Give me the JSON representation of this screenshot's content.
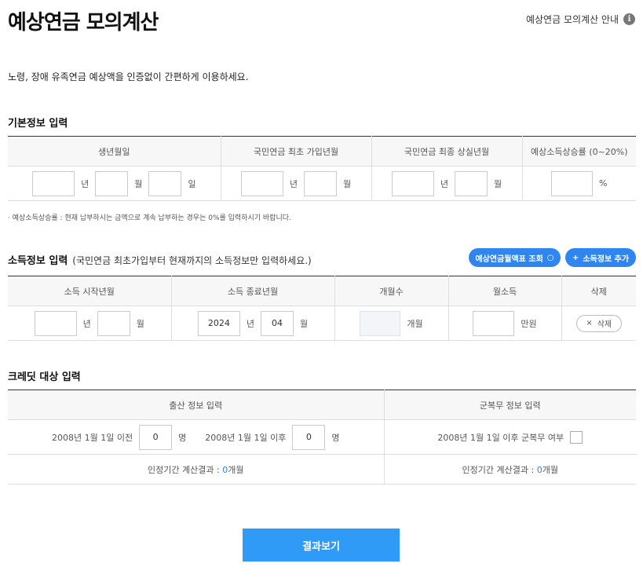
{
  "header": {
    "title": "예상연금 모의계산",
    "guide_label": "예상연금 모의계산 안내",
    "guide_icon": "info-icon",
    "guide_icon_glyph": "i"
  },
  "intro": "노령, 장애 유족연금 예상액을 인증없이 간편하게 이용하세요.",
  "basic": {
    "title": "기본정보 입력",
    "headers": [
      "생년월일",
      "국민연금 최초 가입년월",
      "국민연금 최종 상실년월",
      "예상소득상승률 (0~20%)"
    ],
    "units": {
      "year": "년",
      "month": "월",
      "day": "일",
      "percent": "%"
    },
    "values": {
      "birth_year": "",
      "birth_month": "",
      "birth_day": "",
      "first_year": "",
      "first_month": "",
      "last_year": "",
      "last_month": "",
      "rate": ""
    },
    "note": "예상소득상승률 : 현재 납부하시는 금액으로 계속 납부하는 경우는 0%를 입력하시기 바랍니다."
  },
  "income": {
    "title": "소득정보 입력",
    "subtitle": "(국민연금 최초가입부터 현재까지의 소득정보만 입력하세요.)",
    "lookup_button": "예상연금월액표 조회",
    "lookup_icon": "search-icon",
    "lookup_glyph": "○",
    "add_button": "소득정보 추가",
    "add_glyph": "+",
    "headers": [
      "소득 시작년월",
      "소득 종료년월",
      "개월수",
      "월소득",
      "삭제"
    ],
    "units": {
      "year": "년",
      "month": "월",
      "months": "개월",
      "manwon": "만원"
    },
    "row": {
      "start_year": "",
      "start_month": "",
      "end_year": "2024",
      "end_month": "04",
      "months": "",
      "income": "",
      "delete_label": "삭제",
      "delete_glyph": "×"
    }
  },
  "credit": {
    "title": "크레딧 대상 입력",
    "headers": [
      "출산 정보 입력",
      "군복무 정보 입력"
    ],
    "before_label": "2008년 1월 1일 이전",
    "before_value": "0",
    "after_label": "2008년 1월 1일 이후",
    "after_value": "0",
    "person_unit": "명",
    "military_label": "2008년 1월 1일 이후 군복무 여부",
    "military_checked": false,
    "birth_result_label": "인정기간 계산결과 : ",
    "birth_result_value": "0",
    "military_result_label": "인정기간 계산결과 : ",
    "military_result_value": "0",
    "result_unit": "개월"
  },
  "submit_label": "결과보기"
}
